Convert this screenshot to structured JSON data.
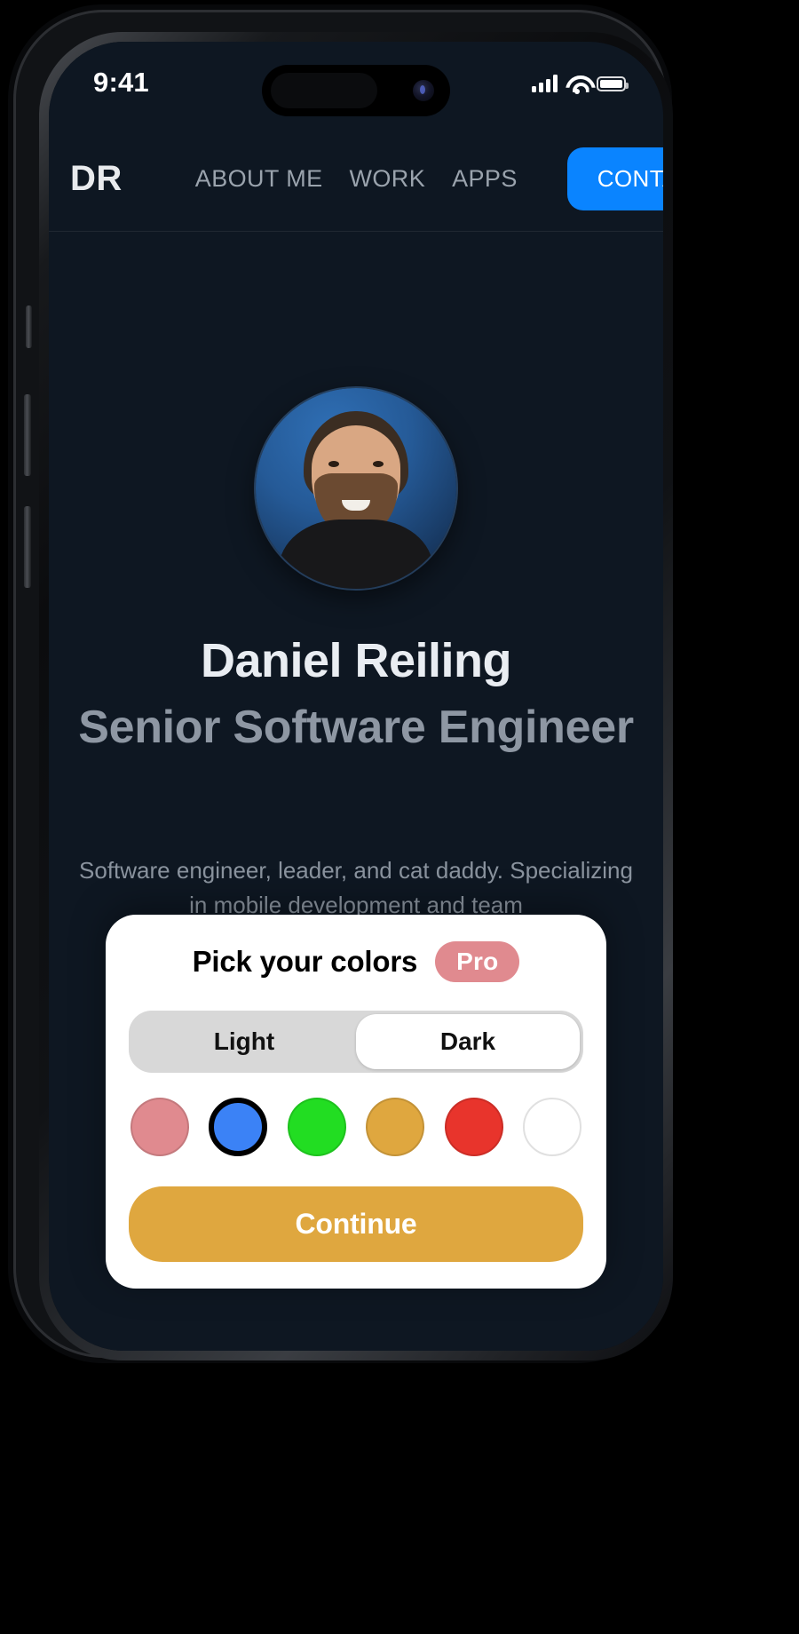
{
  "status_bar": {
    "time": "9:41",
    "signal_icon": "cellular-signal-icon",
    "wifi_icon": "wifi-icon",
    "battery_icon": "battery-icon"
  },
  "nav": {
    "logo": "DR",
    "links": [
      {
        "label": "ABOUT ME"
      },
      {
        "label": "WORK"
      },
      {
        "label": "APPS"
      }
    ],
    "cta": {
      "label": "CONTACT",
      "color": "#0a84ff"
    }
  },
  "hero": {
    "avatar_alt": "profile-photo",
    "name": "Daniel Reiling",
    "role": "Senior Software Engineer",
    "blurb": "Software engineer, leader, and cat daddy. Specializing in mobile development and team"
  },
  "modal": {
    "title": "Pick your colors",
    "badge": {
      "label": "Pro",
      "color": "#e08a8f"
    },
    "appearance": {
      "options": [
        {
          "label": "Light",
          "selected": false
        },
        {
          "label": "Dark",
          "selected": true
        }
      ]
    },
    "swatches": [
      {
        "name": "white",
        "color": "#ffffff",
        "selected": false
      },
      {
        "name": "pink",
        "color": "#e08a8f",
        "selected": false
      },
      {
        "name": "blue",
        "color": "#3b82f6",
        "selected": true
      },
      {
        "name": "green",
        "color": "#22dd22",
        "selected": false
      },
      {
        "name": "amber",
        "color": "#dfa73f",
        "selected": false
      },
      {
        "name": "red",
        "color": "#e8342c",
        "selected": false
      }
    ],
    "continue": {
      "label": "Continue",
      "color": "#dfa73f"
    }
  },
  "theme": {
    "screen_bg": "#0e1722",
    "accent": "#0a84ff",
    "text_primary": "#e9edf2",
    "text_muted": "#8e97a3"
  }
}
